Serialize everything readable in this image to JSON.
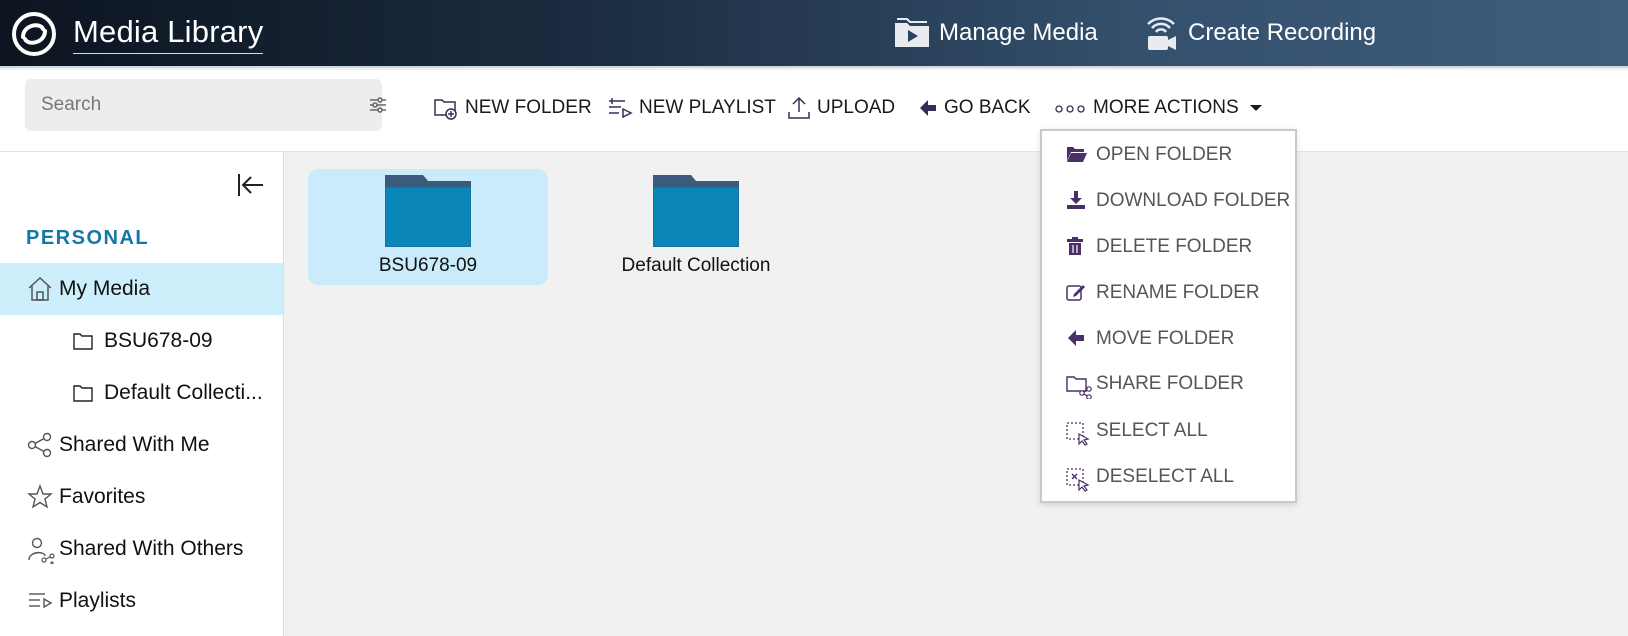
{
  "header": {
    "app_title": "Media Library",
    "manage_media": "Manage Media",
    "create_recording": "Create Recording"
  },
  "toolbar": {
    "search_placeholder": "Search",
    "new_folder": "NEW FOLDER",
    "new_playlist": "NEW PLAYLIST",
    "upload": "UPLOAD",
    "go_back": "GO BACK",
    "more_actions": "MORE ACTIONS"
  },
  "sidebar": {
    "section_title": "PERSONAL",
    "items": [
      {
        "label": "My Media",
        "icon": "home-icon",
        "active": true
      },
      {
        "label": "BSU678-09",
        "icon": "folder-outline-icon"
      },
      {
        "label": "Default Collecti...",
        "icon": "folder-outline-icon"
      },
      {
        "label": "Shared With Me",
        "icon": "share-icon"
      },
      {
        "label": "Favorites",
        "icon": "star-icon"
      },
      {
        "label": "Shared With Others",
        "icon": "user-share-icon"
      },
      {
        "label": "Playlists",
        "icon": "playlist-icon"
      }
    ]
  },
  "folders": [
    {
      "name": "BSU678-09",
      "selected": true
    },
    {
      "name": "Default Collection",
      "selected": false
    }
  ],
  "menu": {
    "items": [
      {
        "label": "OPEN FOLDER",
        "icon": "folder-open-icon"
      },
      {
        "label": "DOWNLOAD FOLDER",
        "icon": "download-icon"
      },
      {
        "label": "DELETE FOLDER",
        "icon": "trash-icon"
      },
      {
        "label": "RENAME FOLDER",
        "icon": "edit-icon"
      },
      {
        "label": "MOVE FOLDER",
        "icon": "arrow-left-icon"
      },
      {
        "label": "SHARE FOLDER",
        "icon": "folder-share-icon"
      },
      {
        "label": "SELECT ALL",
        "icon": "select-all-icon"
      },
      {
        "label": "DESELECT ALL",
        "icon": "deselect-all-icon"
      }
    ]
  },
  "colors": {
    "accent": "#1477a8",
    "folder": "#0b86b8",
    "folder_tab": "#3b5a7c",
    "menu_icon": "#4b2f6b",
    "selected_bg": "#cdeefb"
  }
}
